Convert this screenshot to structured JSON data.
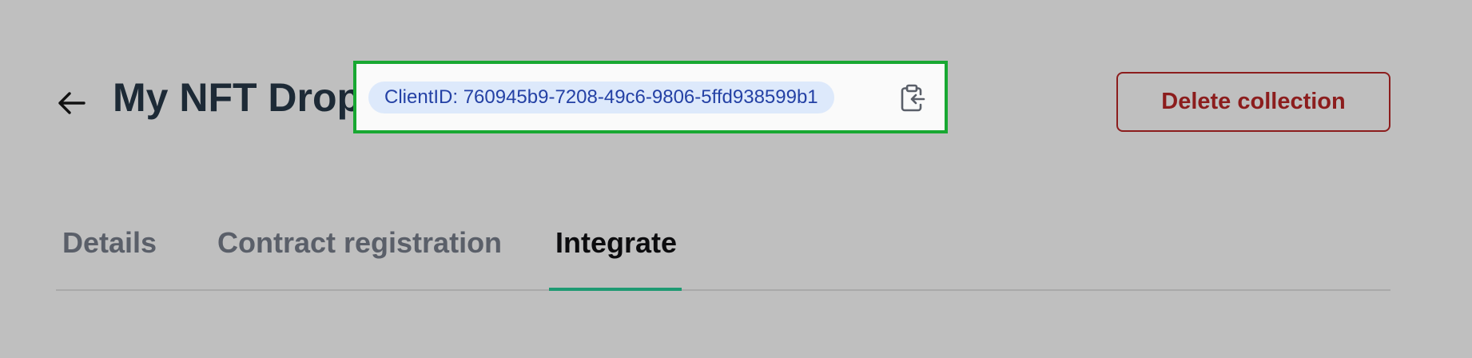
{
  "header": {
    "title": "My NFT Drop",
    "client_id_label": "ClientID: 760945b9-7208-49c6-9806-5ffd938599b1",
    "back_icon": "arrow-left-icon",
    "copy_icon": "clipboard-copy-icon",
    "delete_label": "Delete collection"
  },
  "tabs": [
    {
      "label": "Details",
      "active": false
    },
    {
      "label": "Contract registration",
      "active": false
    },
    {
      "label": "Integrate",
      "active": true
    }
  ],
  "colors": {
    "highlight_border": "#18a832",
    "pill_background": "#dde9fb",
    "pill_text": "#2441a5",
    "delete": "#8c1d1d",
    "active_tab_indicator": "#1e9a72"
  }
}
